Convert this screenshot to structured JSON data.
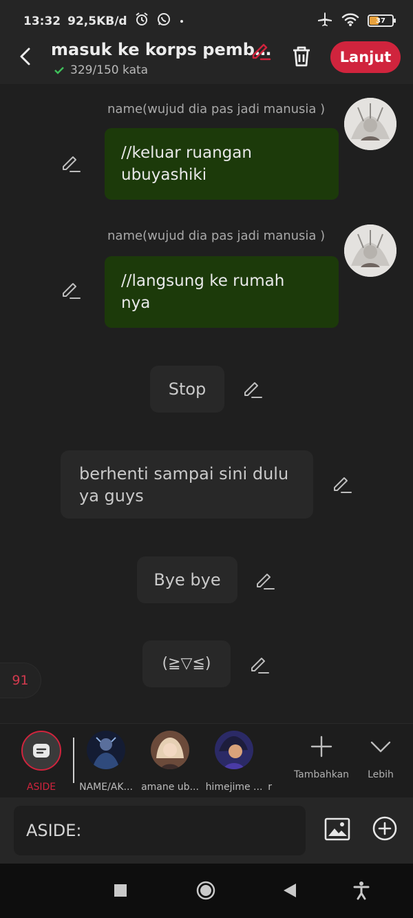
{
  "status": {
    "time": "13:32",
    "speed": "92,5KB/d",
    "battery": "37",
    "battery_level": 0.37
  },
  "header": {
    "title": "masuk ke korps pemb…",
    "word_count": "329/150 kata",
    "next_label": "Lanjut"
  },
  "messages": [
    {
      "sender": "name(wujud dia pas jadi manusia )",
      "line1": "//keluar ruangan",
      "line2": "ubuyashiki"
    },
    {
      "sender": "name(wujud dia pas jadi manusia )",
      "line1": "//langsung ke rumah",
      "line2": "nya"
    }
  ],
  "narration": [
    {
      "text": "Stop"
    },
    {
      "line1": "berhenti sampai sini dulu",
      "line2": "ya guys"
    },
    {
      "text": "Bye bye"
    },
    {
      "text": "(≧▽≦)"
    }
  ],
  "counter": "91",
  "characters": [
    {
      "label": "ASIDE"
    },
    {
      "label": "NAME/AK..."
    },
    {
      "label": "amane ub..."
    },
    {
      "label": "himejime ..."
    },
    {
      "label": "r"
    }
  ],
  "actions": {
    "add_label": "Tambahkan",
    "more_label": "Lebih"
  },
  "composer": {
    "text": "ASIDE:"
  },
  "colors": {
    "accent": "#d0243d",
    "user_bubble": "#1c3a0a",
    "background": "#1f1f1f",
    "check": "#3fbf5a"
  }
}
